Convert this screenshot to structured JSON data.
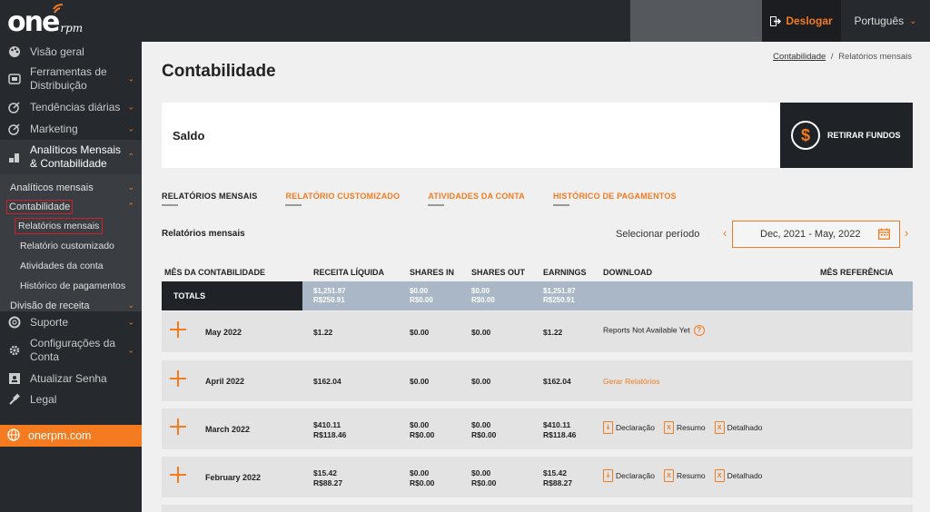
{
  "header": {
    "logo_main": "one",
    "logo_sub": "rpm",
    "logout_label": "Deslogar",
    "language_label": "Português"
  },
  "sidebar": {
    "items_top": [
      {
        "label": "Visão geral",
        "icon": "palette-icon"
      },
      {
        "label": "Ferramentas de Distribuição",
        "icon": "upload-icon"
      },
      {
        "label": "Tendências diárias",
        "icon": "trend-icon"
      },
      {
        "label": "Marketing",
        "icon": "megaphone-icon"
      },
      {
        "label": "Analíticos Mensais & Contabilidade",
        "icon": "coins-icon"
      }
    ],
    "sub": {
      "analiticos": "Analíticos mensais",
      "contabilidade": "Contabilidade",
      "children": [
        "Relatórios mensais",
        "Relatório customizado",
        "Atividades da conta",
        "Histórico de pagamentos"
      ],
      "divisao": "Divisão de receita"
    },
    "items_bottom": [
      {
        "label": "Suporte",
        "icon": "lifebuoy-icon"
      },
      {
        "label": "Configurações da Conta",
        "icon": "gear-icon"
      },
      {
        "label": "Atualizar Senha",
        "icon": "id-card-icon"
      },
      {
        "label": "Legal",
        "icon": "gavel-icon"
      }
    ],
    "website": "onerpm.com"
  },
  "breadcrumb": {
    "link": "Contabilidade",
    "separator": "/",
    "current": "Relatórios mensais"
  },
  "page": {
    "title": "Contabilidade",
    "saldo_label": "Saldo",
    "withdraw_label": "RETIRAR FUNDOS"
  },
  "tabs": [
    "RELATÓRIOS MENSAIS",
    "RELATÓRIO CUSTOMIZADO",
    "ATIVIDADES DA CONTA",
    "HISTÓRICO DE PAGAMENTOS"
  ],
  "reports": {
    "section_label": "Relatórios mensais",
    "period_label": "Selecionar período",
    "period_value": "Dec, 2021 - May, 2022"
  },
  "table": {
    "headers": [
      "MÊS DA CONTABILIDADE",
      "RECEITA LÍQUIDA",
      "SHARES IN",
      "SHARES OUT",
      "EARNINGS",
      "DOWNLOAD",
      "MÊS REFERÊNCIA"
    ],
    "totals": {
      "label": "TOTALS",
      "receita": [
        "$1,251.87",
        "R$250.91"
      ],
      "shares_in": [
        "$0.00",
        "R$0.00"
      ],
      "shares_out": [
        "$0.00",
        "R$0.00"
      ],
      "earnings": [
        "$1,251.87",
        "R$250.91"
      ]
    },
    "rows": [
      {
        "month": "May 2022",
        "receita": [
          "$1.22"
        ],
        "shares_in": [
          "$0.00"
        ],
        "shares_out": [
          "$0.00"
        ],
        "earnings": [
          "$1.22"
        ],
        "download": "Reports Not Available Yet"
      },
      {
        "month": "April 2022",
        "receita": [
          "$162.04"
        ],
        "shares_in": [
          "$0.00"
        ],
        "shares_out": [
          "$0.00"
        ],
        "earnings": [
          "$162.04"
        ],
        "download": "Gerar Relatórios"
      },
      {
        "month": "March 2022",
        "receita": [
          "$410.11",
          "R$118.46"
        ],
        "shares_in": [
          "$0.00",
          "R$0.00"
        ],
        "shares_out": [
          "$0.00",
          "R$0.00"
        ],
        "earnings": [
          "$410.11",
          "R$118.46"
        ]
      },
      {
        "month": "February 2022",
        "receita": [
          "$15.42",
          "R$88.27"
        ],
        "shares_in": [
          "$0.00",
          "R$0.00"
        ],
        "shares_out": [
          "$0.00",
          "R$0.00"
        ],
        "earnings": [
          "$15.42",
          "R$88.27"
        ]
      }
    ],
    "download_links": [
      "Declaração",
      "Resumo",
      "Detalhado"
    ]
  },
  "colors": {
    "accent": "#f47b20",
    "sidebar_bg": "#26292d",
    "totals_bg": "#a9b7c6"
  }
}
